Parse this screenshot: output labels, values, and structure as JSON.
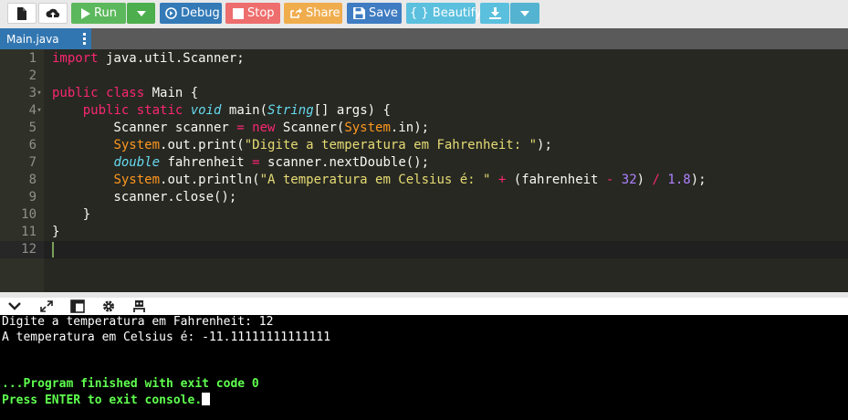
{
  "toolbar": {
    "run_label": "Run",
    "debug_label": "Debug",
    "stop_label": "Stop",
    "share_label": "Share",
    "save_label": "Save",
    "beautify_label": "{ } Beautify"
  },
  "file_tab": {
    "name": "Main.java"
  },
  "editor": {
    "line_numbers": [
      "1",
      "2",
      "3",
      "4",
      "5",
      "6",
      "7",
      "8",
      "9",
      "10",
      "11",
      "12"
    ]
  },
  "console": {
    "lines": [
      "Digite a temperatura em Fahrenheit: 12",
      "A temperatura em Celsius é: -11.11111111111111",
      "",
      "",
      "...Program finished with exit code 0",
      "Press ENTER to exit console."
    ]
  },
  "colors": {
    "run": "#5cb85c",
    "debug": "#337ab7",
    "stop": "#ee6d6d",
    "share": "#f0ad4e",
    "save": "#3f7cc2",
    "beautify": "#5bc0de",
    "tab": "#3276b1",
    "editor_bg": "#272822",
    "console_bg": "#000000",
    "console_exit": "#5fff4f"
  },
  "icons": [
    "new-file-icon",
    "upload-icon",
    "play-icon",
    "caret-down-icon",
    "debug-icon",
    "stop-icon",
    "share-icon",
    "save-icon",
    "download-icon",
    "kebab-menu-icon",
    "collapse-icon",
    "expand-icon",
    "layout-icon",
    "gear-icon",
    "stdin-icon"
  ]
}
